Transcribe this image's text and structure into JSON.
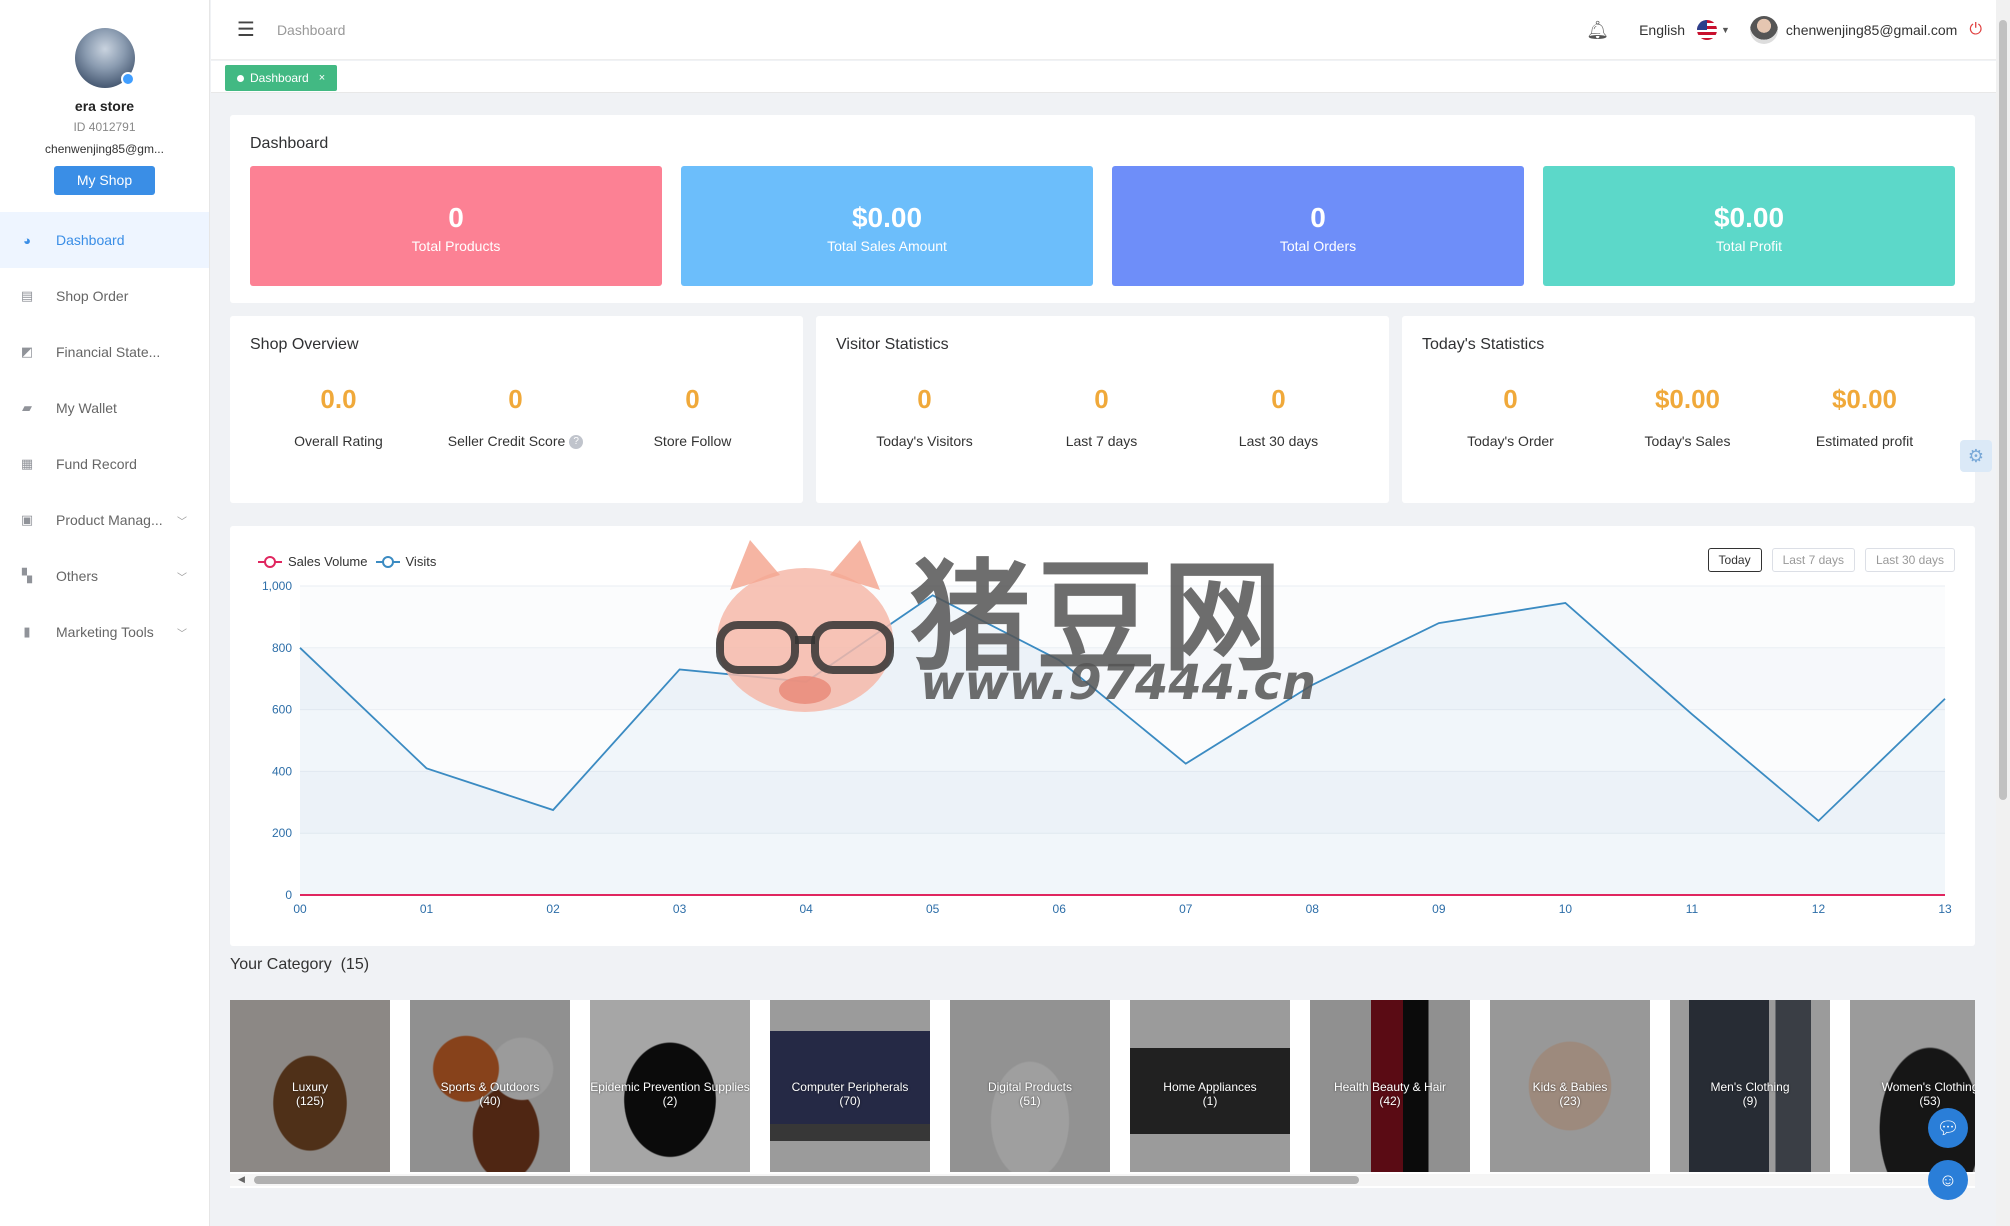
{
  "sidebar": {
    "store_name": "era store",
    "store_id": "ID 4012791",
    "email": "chenwenjing85@gm...",
    "myshop_label": "My Shop",
    "items": [
      {
        "label": "Dashboard",
        "icon": "dashboard-icon"
      },
      {
        "label": "Shop Order",
        "icon": "clipboard-icon"
      },
      {
        "label": "Financial State...",
        "icon": "chart-icon"
      },
      {
        "label": "My Wallet",
        "icon": "wallet-icon"
      },
      {
        "label": "Fund Record",
        "icon": "document-icon"
      },
      {
        "label": "Product Manag...",
        "icon": "briefcase-icon"
      },
      {
        "label": "Others",
        "icon": "grid-icon"
      },
      {
        "label": "Marketing Tools",
        "icon": "bar-chart-icon"
      }
    ]
  },
  "header": {
    "breadcrumb": "Dashboard",
    "language": "English",
    "email": "chenwenjing85@gmail.com"
  },
  "tabs": [
    {
      "label": "Dashboard"
    }
  ],
  "dashboard": {
    "title": "Dashboard",
    "kpis": [
      {
        "value": "0",
        "label": "Total Products",
        "color": "#fc8194"
      },
      {
        "value": "$0.00",
        "label": "Total Sales Amount",
        "color": "#6cbefb"
      },
      {
        "value": "0",
        "label": "Total Orders",
        "color": "#6e8ef9"
      },
      {
        "value": "$0.00",
        "label": "Total Profit",
        "color": "#5cd8c9"
      }
    ]
  },
  "shop_overview": {
    "title": "Shop Overview",
    "stats": [
      {
        "value": "0.0",
        "label": "Overall Rating"
      },
      {
        "value": "0",
        "label": "Seller Credit Score"
      },
      {
        "value": "0",
        "label": "Store Follow"
      }
    ]
  },
  "visitor_statistics": {
    "title": "Visitor Statistics",
    "stats": [
      {
        "value": "0",
        "label": "Today's Visitors"
      },
      {
        "value": "0",
        "label": "Last 7 days"
      },
      {
        "value": "0",
        "label": "Last 30 days"
      }
    ]
  },
  "today_statistics": {
    "title": "Today's Statistics",
    "stats": [
      {
        "value": "0",
        "label": "Today's Order"
      },
      {
        "value": "$0.00",
        "label": "Today's Sales"
      },
      {
        "value": "$0.00",
        "label": "Estimated profit"
      }
    ]
  },
  "range_buttons": [
    "Today",
    "Last 7 days",
    "Last 30 days"
  ],
  "chart_data": {
    "type": "line",
    "x": [
      "00",
      "01",
      "02",
      "03",
      "04",
      "05",
      "06",
      "07",
      "08",
      "09",
      "10",
      "11",
      "12",
      "13"
    ],
    "series": [
      {
        "name": "Sales Volume",
        "color": "#e0265f",
        "values": [
          0,
          0,
          0,
          0,
          0,
          0,
          0,
          0,
          0,
          0,
          0,
          0,
          0,
          0
        ]
      },
      {
        "name": "Visits",
        "color": "#3b8bc2",
        "values": [
          800,
          410,
          275,
          730,
          690,
          970,
          760,
          425,
          680,
          880,
          945,
          585,
          240,
          635
        ]
      }
    ],
    "ylim": [
      0,
      1000
    ],
    "yticks": [
      0,
      200,
      400,
      600,
      800,
      1000
    ],
    "ytick_labels": [
      "0",
      "200",
      "400",
      "600",
      "800",
      "1,000"
    ],
    "legend": "top-left",
    "grid": true
  },
  "category": {
    "title": "Your Category",
    "count": "(15)",
    "items": [
      {
        "name": "Luxury",
        "count": "(125)"
      },
      {
        "name": "Sports & Outdoors",
        "count": "(40)"
      },
      {
        "name": "Epidemic Prevention Supplies",
        "count": "(2)"
      },
      {
        "name": "Computer Peripherals",
        "count": "(70)"
      },
      {
        "name": "Digital Products",
        "count": "(51)"
      },
      {
        "name": "Home Appliances",
        "count": "(1)"
      },
      {
        "name": "Health Beauty & Hair",
        "count": "(42)"
      },
      {
        "name": "Kids & Babies",
        "count": "(23)"
      },
      {
        "name": "Men's Clothing",
        "count": "(9)"
      },
      {
        "name": "Women's Clothing",
        "count": "(53)"
      }
    ]
  },
  "watermark": {
    "text": "猪豆网",
    "url": "www.97444.cn"
  }
}
